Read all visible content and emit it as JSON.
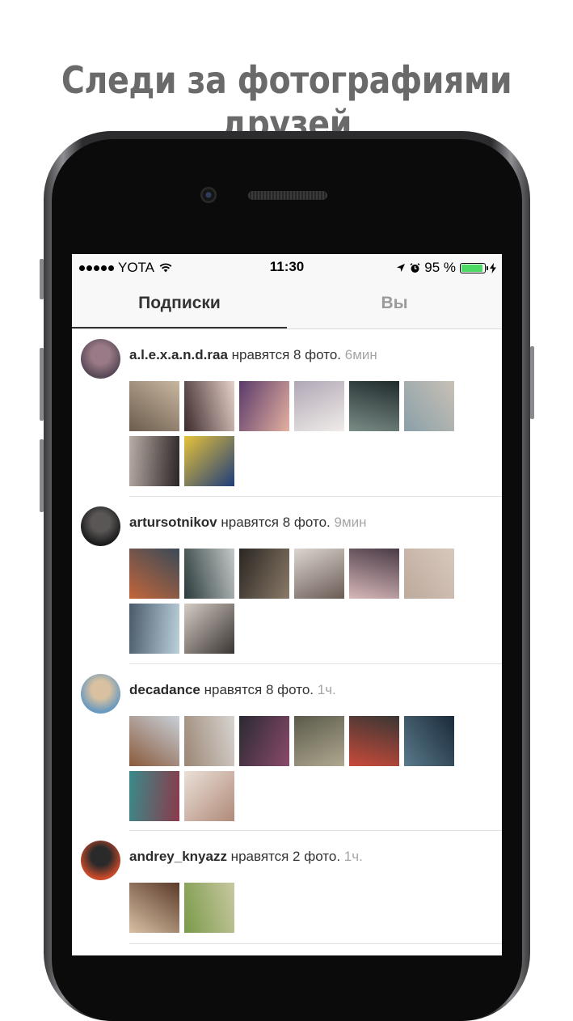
{
  "headline": "Следи за фотографиями друзей",
  "status_bar": {
    "carrier": "YOTA",
    "time": "11:30",
    "battery_percent": "95 %",
    "battery_level": 0.95,
    "icons": [
      "signal-dots-icon",
      "wifi-icon",
      "location-arrow-icon",
      "alarm-icon",
      "battery-icon",
      "charging-icon"
    ]
  },
  "tabs": [
    {
      "label": "Подписки",
      "active": true
    },
    {
      "label": "Вы",
      "active": false
    }
  ],
  "feed": [
    {
      "username": "a.l.e.x.a.n.d.raa",
      "action": " нравятся 8 фото. ",
      "time": "6мин",
      "avatar": [
        "#5a4a58",
        "#9a7a86"
      ],
      "photos": [
        [
          "#6b5c4d",
          "#c9b7a0"
        ],
        [
          "#3b2a2c",
          "#e7d0c8"
        ],
        [
          "#5a3a6a",
          "#e4b0a0"
        ],
        [
          "#b0a7b5",
          "#f0ece9"
        ],
        [
          "#1f2a2c",
          "#7a8c86"
        ],
        [
          "#c8c0b6",
          "#8aa0a8"
        ],
        [
          "#2a2424",
          "#b9ada6"
        ],
        [
          "#1e3c7a",
          "#e6c23a"
        ]
      ]
    },
    {
      "username": "artursotnikov",
      "action": " нравятся 8 фото. ",
      "time": "9мин",
      "avatar": [
        "#1c1c1c",
        "#5a5656"
      ],
      "photos": [
        [
          "#c2653a",
          "#3a4a58"
        ],
        [
          "#2a3a3a",
          "#c4c8c8"
        ],
        [
          "#2a2622",
          "#8a7a68"
        ],
        [
          "#dcd6d0",
          "#6a5a54"
        ],
        [
          "#4a3a46",
          "#d6b8b8"
        ],
        [
          "#d8c8bc",
          "#bcaa9c"
        ],
        [
          "#bcd0dc",
          "#4a5a6a"
        ],
        [
          "#3a3432",
          "#d4ccc4"
        ]
      ]
    },
    {
      "username": "decadance",
      "action": " нравятся 8 фото. ",
      "time": "1ч.",
      "avatar": [
        "#6a9abf",
        "#d8c0a0"
      ],
      "photos": [
        [
          "#8a5a3c",
          "#c8d0d8"
        ],
        [
          "#9a8674",
          "#d8d4d0"
        ],
        [
          "#2a2a32",
          "#8a4a6a"
        ],
        [
          "#5a5a4a",
          "#b0a890"
        ],
        [
          "#3a3634",
          "#c84a3a"
        ],
        [
          "#1a2a3a",
          "#5a7a8a"
        ],
        [
          "#8a3a4a",
          "#3a8a8a"
        ],
        [
          "#b08a78",
          "#eae0d8"
        ]
      ]
    },
    {
      "username": "andrey_knyazz",
      "action": " нравятся 2 фото. ",
      "time": "1ч.",
      "avatar": [
        "#c84a2a",
        "#2a2a2a"
      ],
      "photos": [
        [
          "#d8c0a4",
          "#5a3a2a"
        ],
        [
          "#7a9a4a",
          "#c8c8a0"
        ]
      ]
    }
  ]
}
